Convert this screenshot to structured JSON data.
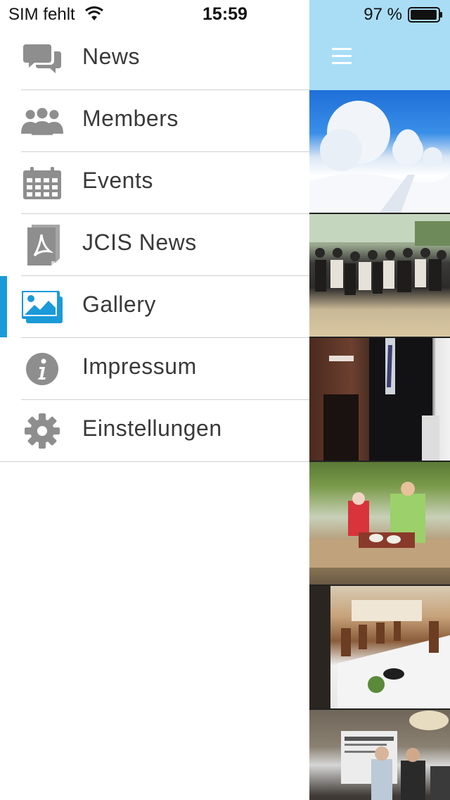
{
  "status_bar": {
    "carrier": "SIM fehlt",
    "time": "15:59",
    "battery_percent": "97 %",
    "battery_level": 0.97
  },
  "menu": {
    "items": [
      {
        "label": "News",
        "icon": "chat-bubbles-icon"
      },
      {
        "label": "Members",
        "icon": "people-icon"
      },
      {
        "label": "Events",
        "icon": "calendar-icon"
      },
      {
        "label": "JCIS News",
        "icon": "pdf-document-icon"
      },
      {
        "label": "Gallery",
        "icon": "image-gallery-icon",
        "active": true
      },
      {
        "label": "Impressum",
        "icon": "info-icon"
      },
      {
        "label": "Einstellungen",
        "icon": "gear-icon"
      }
    ]
  },
  "header": {
    "menu_icon": "hamburger-menu-icon",
    "background_color": "#a9ddf6"
  },
  "colors": {
    "accent": "#1a9ad9",
    "icon_gray": "#8e8e8e",
    "gallery_icon": "#1a9ad9"
  },
  "gallery": {
    "thumbnail_count": 6
  }
}
